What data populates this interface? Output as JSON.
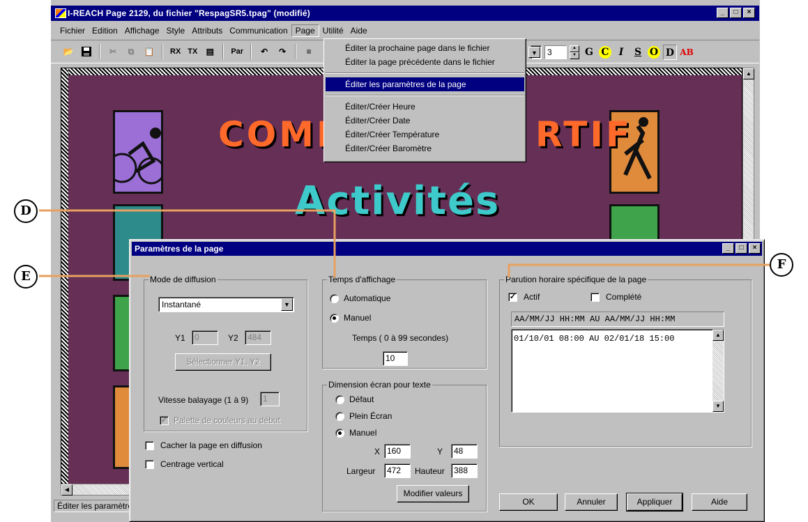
{
  "app": {
    "title": "I-REACH  Page 2129,  du fichier \"RespagSR5.tpag\"  (modifié)",
    "window_buttons": [
      "_",
      "□",
      "×"
    ]
  },
  "menubar": [
    {
      "label": "Fichier"
    },
    {
      "label": "Edition"
    },
    {
      "label": "Affichage"
    },
    {
      "label": "Style"
    },
    {
      "label": "Attributs"
    },
    {
      "label": "Communication"
    },
    {
      "label": "Page"
    },
    {
      "label": "Utilité"
    },
    {
      "label": "Aide"
    }
  ],
  "toolbar": {
    "rx": "RX",
    "tx": "TX",
    "par": "Par",
    "font_size": "3",
    "fmt": [
      "G",
      "C",
      "I",
      "S",
      "O",
      "D",
      "AB"
    ]
  },
  "page_menu": {
    "items": [
      "Éditer la prochaine page dans le fichier",
      "Éditer la page précédente dans le fichier",
      "Éditer les paramètres de la page",
      "Éditer/Créer Heure",
      "Éditer/Créer Date",
      "Éditer/Créer Température",
      "Éditer/Créer Baromètre"
    ]
  },
  "canvas": {
    "headline1_left": "COMP",
    "headline1_right": "RTIF",
    "headline2": "Activités",
    "bg_color": "#652f56",
    "tile_colors": [
      "#9b6fd6",
      "#e08a3c",
      "#2e8b8b",
      "#3ea34a",
      "#3ea34a",
      "#e08a3c"
    ]
  },
  "status": {
    "text": "Éditer les paramètres de la page"
  },
  "dialog": {
    "title": "Paramètres de la page",
    "mode": {
      "group": "Mode de diffusion",
      "select_value": "Instantané",
      "y1_label": "Y1",
      "y1_value": "0",
      "y2_label": "Y2",
      "y2_value": "484",
      "select_btn": "Sélectionner Y1, Y2",
      "speed_label": "Vitesse balayage (1 à 9)",
      "speed_value": "1",
      "palette_label": "Palette de couleurs au début"
    },
    "hide_label": "Cacher la page en diffusion",
    "center_label": "Centrage vertical",
    "display_time": {
      "group": "Temps d'affichage",
      "auto": "Automatique",
      "manual": "Manuel",
      "time_label": "Temps  ( 0 à  99 secondes)",
      "time_value": "10"
    },
    "screen": {
      "group": "Dimension écran pour texte",
      "default": "Défaut",
      "full": "Plein Écran",
      "manual": "Manuel",
      "x_label": "X",
      "x_value": "160",
      "y_label": "Y",
      "y_value": "48",
      "w_label": "Largeur",
      "w_value": "472",
      "h_label": "Hauteur",
      "h_value": "388",
      "modify_btn": "Modifier valeurs"
    },
    "schedule": {
      "group": "Parution horaire spécifique de la page",
      "active": "Actif",
      "completed": "Complété",
      "header": "AA/MM/JJ HH:MM AU AA/MM/JJ HH:MM",
      "rows": [
        "01/10/01 08:00 AU 02/01/18 15:00"
      ]
    },
    "buttons": {
      "ok": "OK",
      "cancel": "Annuler",
      "apply": "Appliquer",
      "help": "Aide"
    }
  },
  "callouts": {
    "d": "D",
    "e": "E",
    "f": "F"
  },
  "accent_colors": {
    "callout_line": "#e8a060",
    "titlebar": "#000080"
  }
}
